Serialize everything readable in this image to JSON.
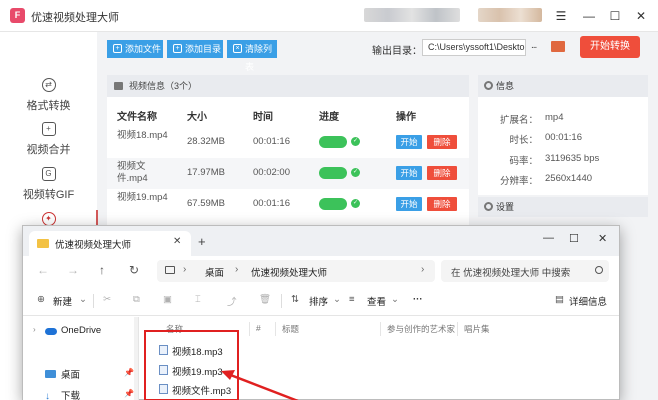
{
  "app": {
    "title": "优速视频处理大师",
    "window_controls": [
      "☰",
      "—",
      "☐",
      "✕"
    ],
    "sidebar": [
      {
        "label": "格式转换",
        "icon": "convert-icon"
      },
      {
        "label": "视频合并",
        "icon": "merge-icon"
      },
      {
        "label": "视频转GIF",
        "icon": "gif-icon"
      },
      {
        "label": "",
        "icon": "tools-icon"
      }
    ],
    "toolbar": {
      "add_file": "添加文件",
      "add_dir": "添加目录",
      "clear_list": "清除列表",
      "output_label": "输出目录：",
      "output_path": "C:\\Users\\yssoft1\\Deskto",
      "browse": "...",
      "start_convert": "开始转换"
    },
    "file_panel": {
      "header": "视频信息（3个）",
      "columns": [
        "文件名称",
        "大小",
        "时间",
        "进度",
        "操作"
      ],
      "rows": [
        {
          "name": "视频18.mp4",
          "size": "28.32MB",
          "time": "00:01:16",
          "start": "开始",
          "delete": "删除"
        },
        {
          "name": "视频文件.mp4",
          "size": "17.97MB",
          "time": "00:02:00",
          "start": "开始",
          "delete": "删除"
        },
        {
          "name": "视频19.mp4",
          "size": "67.59MB",
          "time": "00:01:16",
          "start": "开始",
          "delete": "删除"
        }
      ]
    },
    "info_panel": {
      "header": "信息",
      "rows": [
        {
          "key": "扩展名：",
          "value": "mp4"
        },
        {
          "key": "时长：",
          "value": "00:01:16"
        },
        {
          "key": "码率：",
          "value": "3119635 bps"
        },
        {
          "key": "分辨率：",
          "value": "2560x1440"
        }
      ],
      "settings_header": "设置"
    },
    "colors": {
      "accent_blue": "#3a9fe6",
      "accent_red": "#ef4e3b",
      "progress_green": "#3cc25a"
    }
  },
  "explorer": {
    "tab_title": "优速视频处理大师",
    "tab_close": "✕",
    "tab_add": "+",
    "window_controls": [
      "—",
      "☐",
      "✕"
    ],
    "nav": {
      "back": "←",
      "forward": "→",
      "up": "↑",
      "refresh": "↻"
    },
    "breadcrumb": [
      "桌面",
      "优速视频处理大师"
    ],
    "search_placeholder": "在 优速视频处理大师 中搜索",
    "commands": {
      "new": "新建",
      "sort": "排序",
      "view": "查看",
      "more": "···",
      "details": "详细信息"
    },
    "sidebar": [
      {
        "label": "OneDrive",
        "pinned": false
      },
      {
        "label": "桌面",
        "pinned": true
      },
      {
        "label": "下载",
        "pinned": true
      }
    ],
    "columns": [
      "名称",
      "#",
      "标题",
      "参与创作的艺术家",
      "唱片集"
    ],
    "files": [
      "视频18.mp3",
      "视频19.mp3",
      "视频文件.mp3"
    ]
  }
}
